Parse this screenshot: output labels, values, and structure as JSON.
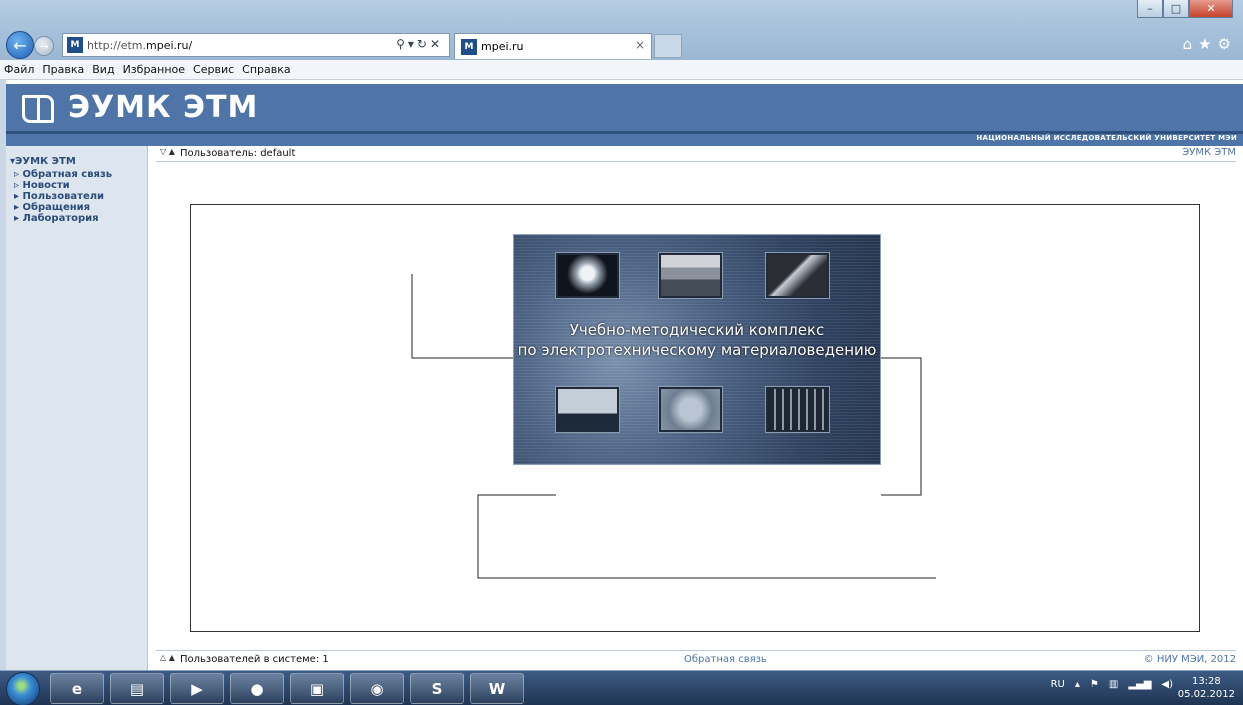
{
  "browser": {
    "url_prefix": "http://etm.",
    "url_domain": "mpei.ru/",
    "tab_title": "mpei.ru",
    "menu": [
      "Файл",
      "Правка",
      "Вид",
      "Избранное",
      "Сервис",
      "Справка"
    ]
  },
  "site": {
    "title": "ЭУМК ЭТМ",
    "subtitle": "НАЦИОНАЛЬНЫЙ ИССЛЕДОВАТЕЛЬСКИЙ УНИВЕРСИТЕТ МЭИ"
  },
  "sidebar": {
    "root": "ЭУМК ЭТМ",
    "items": [
      "Обратная связь",
      "Новости",
      "Пользователи",
      "Обращения",
      "Лаборатория"
    ]
  },
  "topbar": {
    "user_text": "Пользователь: default",
    "right_link": "ЭУМК ЭТМ"
  },
  "splash": {
    "line1": "Учебно-методический комплекс",
    "line2": "по электротехническому материаловедению"
  },
  "footer": {
    "online": "Пользователей в системе: 1",
    "feedback": "Обратная связь",
    "copyright": "© НИУ МЭИ, 2012"
  },
  "taskbar": {
    "lang": "RU",
    "time": "13:28",
    "date": "05.02.2012"
  }
}
